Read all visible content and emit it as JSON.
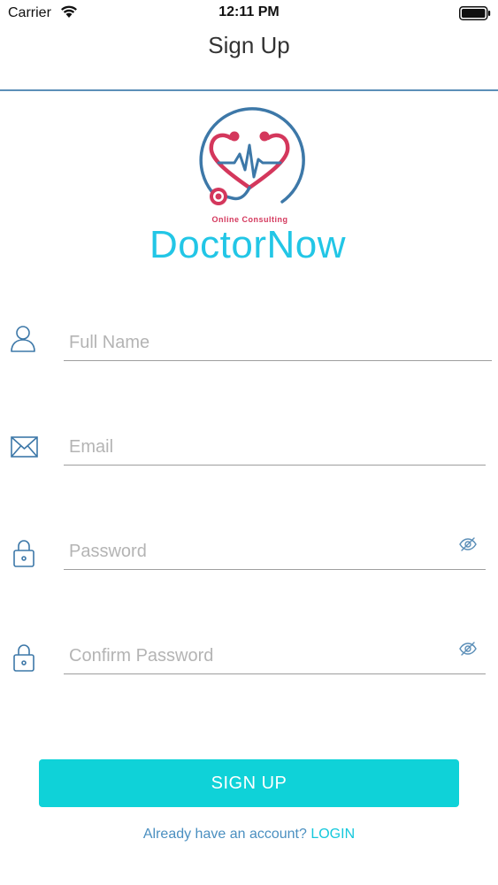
{
  "status_bar": {
    "carrier": "Carrier",
    "time": "12:11 PM"
  },
  "nav": {
    "title": "Sign Up"
  },
  "logo": {
    "tagline": "Online Consulting",
    "wordmark": "DoctorNow"
  },
  "form": {
    "full_name": {
      "placeholder": "Full Name",
      "icon": "user-icon"
    },
    "email": {
      "placeholder": "Email",
      "icon": "envelope-icon"
    },
    "password": {
      "placeholder": "Password",
      "icon": "lock-icon",
      "toggle_icon": "eye-off-icon"
    },
    "confirm_password": {
      "placeholder": "Confirm Password",
      "icon": "lock-icon",
      "toggle_icon": "eye-off-icon"
    }
  },
  "actions": {
    "signup_label": "SIGN UP",
    "login_prompt": "Already have an account?",
    "login_link": "LOGIN"
  },
  "colors": {
    "accent": "#0fd2d8",
    "brand_blue": "#22c6e6",
    "brand_red": "#d4375c",
    "icon_blue": "#3d78a8",
    "divider": "#5c8fb8"
  }
}
